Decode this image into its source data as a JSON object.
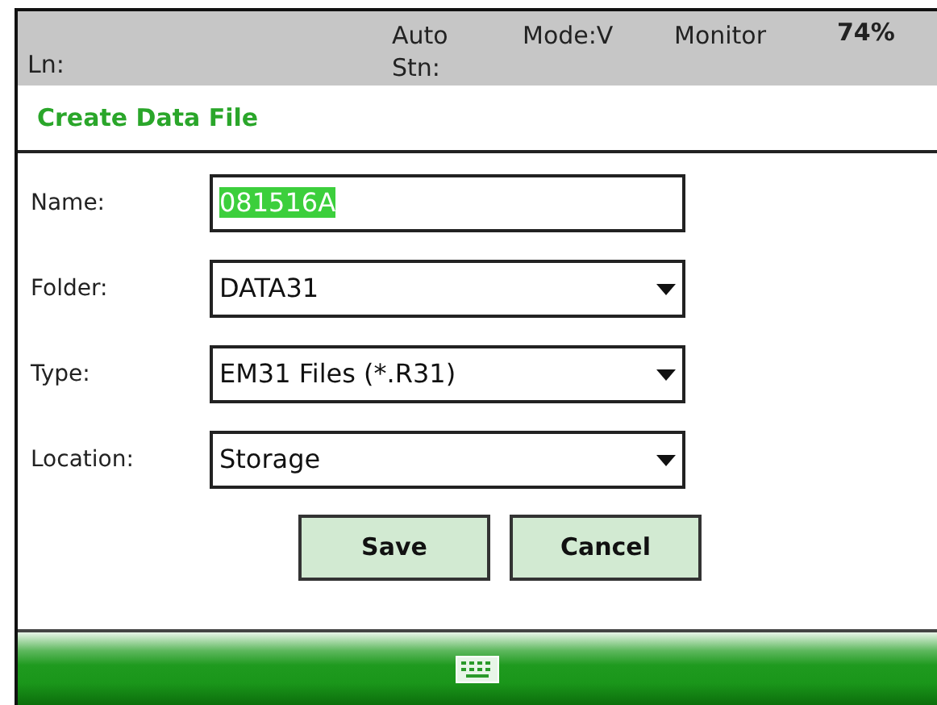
{
  "status_bar": {
    "line": "Ln:",
    "auto": "Auto",
    "station": "Stn:",
    "mode": "Mode:V",
    "monitor": "Monitor",
    "battery": "74%"
  },
  "window": {
    "title": "Create Data File"
  },
  "fields": [
    {
      "label": "Name:",
      "kind": "text",
      "value": "081516A",
      "text_selected": true
    },
    {
      "label": "Folder:",
      "kind": "dropdown",
      "value": "DATA31"
    },
    {
      "label": "Type:",
      "kind": "dropdown",
      "value": "EM31 Files (*.R31)"
    },
    {
      "label": "Location:",
      "kind": "dropdown",
      "value": "Storage"
    }
  ],
  "buttons": [
    "Save",
    "Cancel"
  ]
}
